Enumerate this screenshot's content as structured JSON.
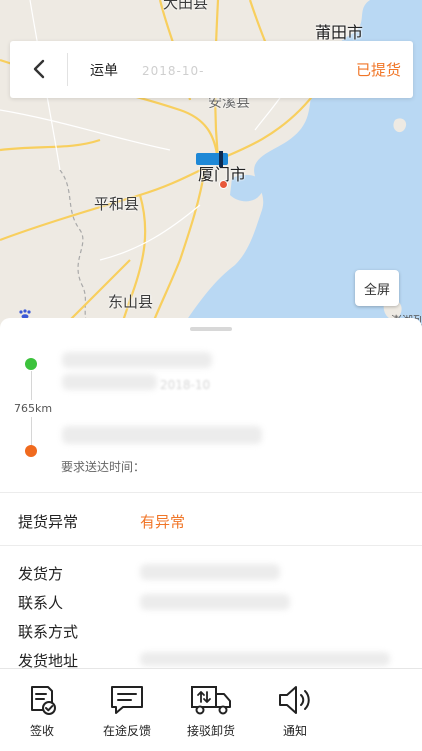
{
  "header": {
    "back_icon": "chevron-left-icon",
    "title": "运单",
    "ghost_text": "2018-10-",
    "status": "已提货"
  },
  "map": {
    "cities": [
      {
        "id": "datian",
        "name": "大田县"
      },
      {
        "id": "putian",
        "name": "莆田市"
      },
      {
        "id": "anxi",
        "name": "安溪县"
      },
      {
        "id": "xiamen",
        "name": "厦门市"
      },
      {
        "id": "pinghe",
        "name": "平和县"
      },
      {
        "id": "dongshan",
        "name": "东山县"
      }
    ],
    "fullscreen_label": "全屏",
    "copyright": "澎湖列"
  },
  "route": {
    "distance": "765km",
    "ghost_date": "2018-10",
    "deadline_label": "要求送达时间："
  },
  "exception": {
    "label": "提货异常",
    "value": "有异常"
  },
  "details": [
    {
      "label": "发货方"
    },
    {
      "label": "联系人"
    },
    {
      "label": "联系方式"
    },
    {
      "label": "发货地址"
    }
  ],
  "actions": [
    {
      "id": "sign",
      "label": "签收",
      "icon": "sign-doc-icon"
    },
    {
      "id": "feedback",
      "label": "在途反馈",
      "icon": "chat-icon"
    },
    {
      "id": "transfer",
      "label": "接驳卸货",
      "icon": "truck-unload-icon"
    },
    {
      "id": "notify",
      "label": "通知",
      "icon": "speaker-icon"
    }
  ],
  "colors": {
    "accent": "#f07628",
    "start_dot": "#3cc23c",
    "end_dot": "#f06a1e",
    "sea": "#b9d8f3",
    "road": "#f8cf5e"
  }
}
